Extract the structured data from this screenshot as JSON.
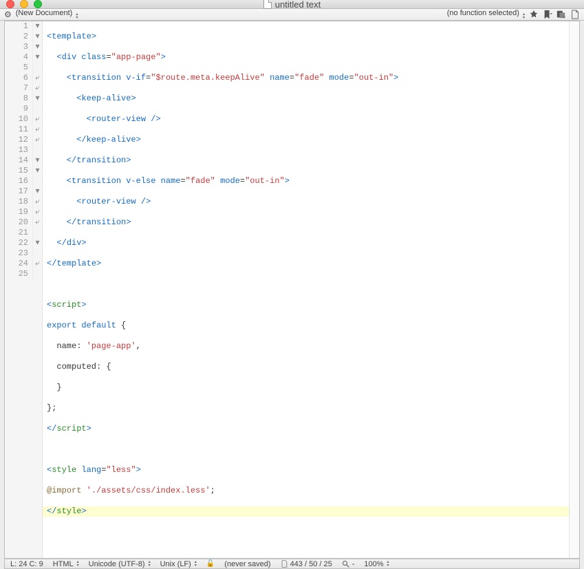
{
  "window": {
    "title": "untitled text"
  },
  "toolbar": {
    "document_label": "(New Document)",
    "function_label": "(no function selected)"
  },
  "gutter": {
    "lines": [
      {
        "n": "1",
        "f": "▾"
      },
      {
        "n": "2",
        "f": "▾"
      },
      {
        "n": "3",
        "f": "▾"
      },
      {
        "n": "4",
        "f": "▾"
      },
      {
        "n": "5",
        "f": ""
      },
      {
        "n": "6",
        "f": "⤶"
      },
      {
        "n": "7",
        "f": "⤶"
      },
      {
        "n": "8",
        "f": "▾"
      },
      {
        "n": "9",
        "f": ""
      },
      {
        "n": "10",
        "f": "⤶"
      },
      {
        "n": "11",
        "f": "⤶"
      },
      {
        "n": "12",
        "f": "⤶"
      },
      {
        "n": "13",
        "f": ""
      },
      {
        "n": "14",
        "f": "▾"
      },
      {
        "n": "15",
        "f": "▾"
      },
      {
        "n": "16",
        "f": ""
      },
      {
        "n": "17",
        "f": "▾"
      },
      {
        "n": "18",
        "f": "⤶"
      },
      {
        "n": "19",
        "f": "⤶"
      },
      {
        "n": "20",
        "f": "⤶"
      },
      {
        "n": "21",
        "f": ""
      },
      {
        "n": "22",
        "f": "▾"
      },
      {
        "n": "23",
        "f": ""
      },
      {
        "n": "24",
        "f": "⤶"
      },
      {
        "n": "25",
        "f": ""
      }
    ]
  },
  "code": {
    "l1": {
      "a": "<",
      "b": "template",
      "c": ">"
    },
    "l2": {
      "a": "  <",
      "b": "div",
      "c": " ",
      "d": "class",
      "e": "=",
      "f": "\"app-page\"",
      "g": ">"
    },
    "l3": {
      "a": "    <",
      "b": "transition",
      "c": " ",
      "d": "v-if",
      "e": "=",
      "f": "\"$route.meta.keepAlive\"",
      "g": " ",
      "h": "name",
      "i": "=",
      "j": "\"fade\"",
      "k": " ",
      "l": "mode",
      "m": "=",
      "n": "\"out-in\"",
      "o": ">"
    },
    "l4": {
      "a": "      <",
      "b": "keep-alive",
      "c": ">"
    },
    "l5": {
      "a": "        <",
      "b": "router-view",
      "c": " />"
    },
    "l6": {
      "a": "      </",
      "b": "keep-alive",
      "c": ">"
    },
    "l7": {
      "a": "    </",
      "b": "transition",
      "c": ">"
    },
    "l8": {
      "a": "    <",
      "b": "transition",
      "c": " ",
      "d": "v-else",
      "e": " ",
      "f": "name",
      "g": "=",
      "h": "\"fade\"",
      "i": " ",
      "j": "mode",
      "k": "=",
      "l": "\"out-in\"",
      "m": ">"
    },
    "l9": {
      "a": "      <",
      "b": "router-view",
      "c": " />"
    },
    "l10": {
      "a": "    </",
      "b": "transition",
      "c": ">"
    },
    "l11": {
      "a": "  </",
      "b": "div",
      "c": ">"
    },
    "l12": {
      "a": "</",
      "b": "template",
      "c": ">"
    },
    "l13": "",
    "l14": {
      "a": "<",
      "b": "script",
      "c": ">"
    },
    "l15": {
      "a": "export",
      "b": " ",
      "c": "default",
      "d": " {"
    },
    "l16": {
      "a": "  name: ",
      "b": "'page-app'",
      "c": ","
    },
    "l17": {
      "a": "  computed: {"
    },
    "l18": {
      "a": "  }"
    },
    "l19": {
      "a": "};"
    },
    "l20": {
      "a": "</",
      "b": "script",
      "c": ">"
    },
    "l21": "",
    "l22": {
      "a": "<",
      "b": "style",
      "c": " ",
      "d": "lang",
      "e": "=",
      "f": "\"less\"",
      "g": ">"
    },
    "l23": {
      "a": "@import",
      "b": " ",
      "c": "'./assets/css/index.less'",
      "d": ";"
    },
    "l24": {
      "a": "</",
      "b": "style",
      "c": ">"
    },
    "l25": ""
  },
  "status": {
    "cursor": "L: 24 C: 9",
    "lang": "HTML",
    "encoding": "Unicode (UTF-8)",
    "lineending": "Unix (LF)",
    "saved": "(never saved)",
    "counts": "443 / 50 / 25",
    "zoom_sym": "-",
    "zoom": "100%"
  }
}
